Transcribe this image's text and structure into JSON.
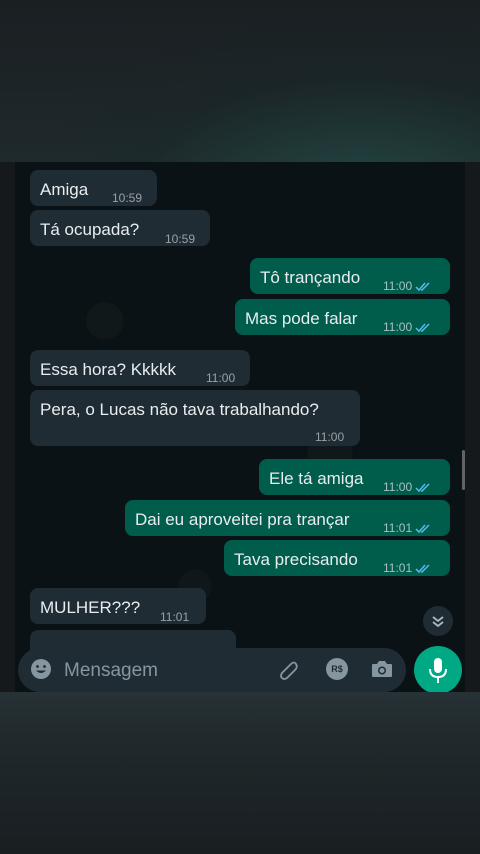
{
  "messages": [
    {
      "dir": "in",
      "text": "Amiga",
      "time": "10:59"
    },
    {
      "dir": "in",
      "text": "Tá ocupada?",
      "time": "10:59"
    },
    {
      "dir": "out",
      "text": "Tô trançando",
      "time": "11:00"
    },
    {
      "dir": "out",
      "text": "Mas pode falar",
      "time": "11:00"
    },
    {
      "dir": "in",
      "text": "Essa hora? Kkkkk",
      "time": "11:00"
    },
    {
      "dir": "in",
      "text": "Pera, o Lucas não tava trabalhando?",
      "time": "11:00"
    },
    {
      "dir": "out",
      "text": "Ele tá amiga",
      "time": "11:00"
    },
    {
      "dir": "out",
      "text": "Dai eu aproveitei pra trançar",
      "time": "11:01"
    },
    {
      "dir": "out",
      "text": "Tava precisando",
      "time": "11:01"
    },
    {
      "dir": "in",
      "text": "MULHER???",
      "time": "11:01"
    }
  ],
  "composer": {
    "placeholder": "Mensagem",
    "emoji_icon": "emoji-icon",
    "attach_icon": "paperclip-icon",
    "payment_icon": "payment-icon",
    "payment_label": "R$",
    "camera_icon": "camera-icon",
    "mic_icon": "mic-icon"
  },
  "colors": {
    "incoming": "#1f2c33",
    "outgoing": "#005c4b",
    "read_ticks": "#53bdeb",
    "accent": "#00a884"
  }
}
